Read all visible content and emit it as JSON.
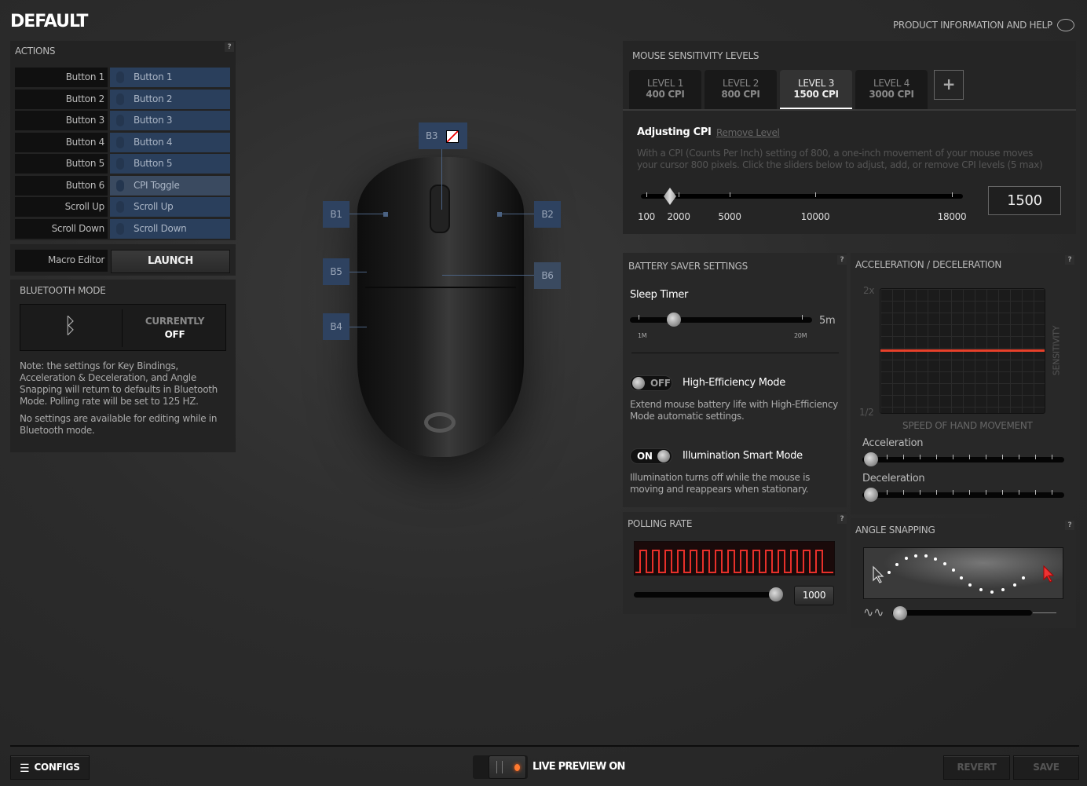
{
  "header": {
    "title": "DEFAULT",
    "help_link": "PRODUCT INFORMATION AND HELP"
  },
  "actions": {
    "title": "ACTIONS",
    "help": "?",
    "rows": [
      {
        "button": "Button 1",
        "action": "Button 1"
      },
      {
        "button": "Button 2",
        "action": "Button 2"
      },
      {
        "button": "Button 3",
        "action": "Button 3"
      },
      {
        "button": "Button 4",
        "action": "Button 4"
      },
      {
        "button": "Button 5",
        "action": "Button 5"
      },
      {
        "button": "Button 6",
        "action": "CPI Toggle"
      },
      {
        "button": "Scroll Up",
        "action": "Scroll Up"
      },
      {
        "button": "Scroll Down",
        "action": "Scroll Down"
      }
    ],
    "macro_label": "Macro Editor",
    "launch": "LAUNCH"
  },
  "bluetooth": {
    "title": "BLUETOOTH MODE",
    "status_label": "CURRENTLY",
    "status": "OFF",
    "note1": "Note: the settings for Key Bindings, Acceleration & Deceleration, and Angle Snapping will return to defaults in Bluetooth Mode. Polling rate will be set to 125 HZ.",
    "note2": "No settings are available for editing while in Bluetooth mode."
  },
  "mouse_labels": {
    "b1": "B1",
    "b2": "B2",
    "b3": "B3",
    "b4": "B4",
    "b5": "B5",
    "b6": "B6"
  },
  "sensitivity": {
    "title": "MOUSE SENSITIVITY LEVELS",
    "levels": [
      {
        "label": "LEVEL 1",
        "cpi": "400 CPI"
      },
      {
        "label": "LEVEL 2",
        "cpi": "800 CPI"
      },
      {
        "label": "LEVEL 3",
        "cpi": "1500 CPI"
      },
      {
        "label": "LEVEL 4",
        "cpi": "3000 CPI"
      }
    ],
    "active_level": 3,
    "add": "+",
    "adjusting": "Adjusting CPI",
    "remove": "Remove Level",
    "description": "With a CPI (Counts Per Inch) setting of 800, a one-inch movement of your mouse moves your cursor 800 pixels. Click the sliders below to adjust, add, or remove CPI levels (5 max)",
    "ticks": [
      "100",
      "2000",
      "5000",
      "10000",
      "18000"
    ],
    "value": "1500"
  },
  "battery": {
    "title": "BATTERY SAVER SETTINGS",
    "help": "?",
    "sleep_timer": "Sleep Timer",
    "sleep_value": "5m",
    "min": "1M",
    "max": "20M",
    "high_eff_state": "OFF",
    "high_eff_label": "High-Efficiency Mode",
    "high_eff_desc": "Extend mouse battery life with High-Efficiency Mode automatic settings.",
    "illum_state": "ON",
    "illum_label": "Illumination Smart Mode",
    "illum_desc": "Illumination turns off while the mouse is moving and reappears when stationary."
  },
  "polling": {
    "title": "POLLING RATE",
    "help": "?",
    "value": "1000"
  },
  "accel": {
    "title": "ACCELERATION / DECELERATION",
    "help": "?",
    "y_max": "2x",
    "y_min": "1/2",
    "x_label": "SPEED OF HAND MOVEMENT",
    "y_label": "SENSITIVITY",
    "acceleration": "Acceleration",
    "deceleration": "Deceleration",
    "curve_color": "#e8402a"
  },
  "angle": {
    "title": "ANGLE SNAPPING",
    "help": "?"
  },
  "footer": {
    "configs": "CONFIGS",
    "live_preview": "LIVE PREVIEW ON",
    "revert": "REVERT",
    "save": "SAVE"
  }
}
